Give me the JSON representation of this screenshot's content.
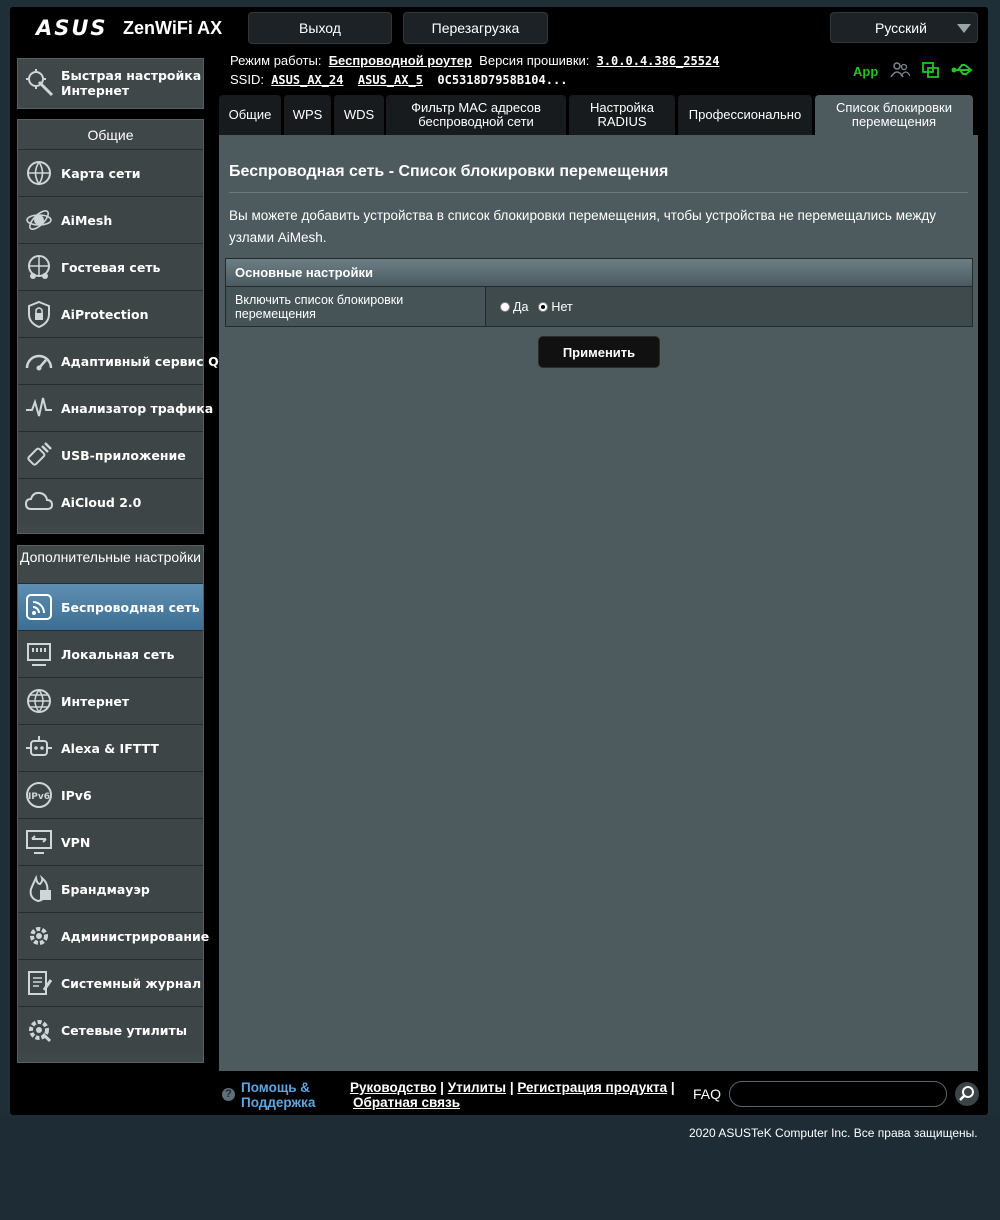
{
  "header": {
    "brand": "ASUS",
    "model": "ZenWiFi AX",
    "logout_label": "Выход",
    "reboot_label": "Перезагрузка",
    "language": "Русский",
    "mode_label": "Режим работы:",
    "mode_value": "Беспроводной роутер",
    "firmware_label": "Версия прошивки:",
    "firmware_value": "3.0.0.4.386_25524",
    "ssid_label": "SSID:",
    "ssid1": "ASUS_AX_24",
    "ssid2": "ASUS_AX_5",
    "ssid3": "0C5318D7958B104...",
    "app_label": "App",
    "accent_color": "#22c422"
  },
  "sidebar": {
    "quick_setup": "Быстрая настройка Интернет",
    "general_title": "Общие",
    "general_items": [
      {
        "label": "Карта сети",
        "icon": "network-map-icon"
      },
      {
        "label": "AiMesh",
        "icon": "aimesh-icon"
      },
      {
        "label": "Гостевая сеть",
        "icon": "guest-network-icon"
      },
      {
        "label": "AiProtection",
        "icon": "aiprotection-lock-icon"
      },
      {
        "label": "Адаптивный сервис QoS",
        "icon": "qos-gauge-icon"
      },
      {
        "label": "Анализатор трафика",
        "icon": "traffic-analyzer-icon"
      },
      {
        "label": "USB-приложение",
        "icon": "usb-icon"
      },
      {
        "label": "AiCloud 2.0",
        "icon": "cloud-icon"
      }
    ],
    "advanced_title": "Дополнительные настройки",
    "advanced_items": [
      {
        "label": "Беспроводная сеть",
        "icon": "wireless-icon",
        "active": true
      },
      {
        "label": "Локальная сеть",
        "icon": "lan-icon"
      },
      {
        "label": "Интернет",
        "icon": "globe-icon"
      },
      {
        "label": "Alexa & IFTTT",
        "icon": "alexa-icon"
      },
      {
        "label": "IPv6",
        "icon": "ipv6-icon"
      },
      {
        "label": "VPN",
        "icon": "vpn-icon"
      },
      {
        "label": "Брандмауэр",
        "icon": "firewall-icon"
      },
      {
        "label": "Администрирование",
        "icon": "gear-icon"
      },
      {
        "label": "Системный журнал",
        "icon": "system-log-icon"
      },
      {
        "label": "Сетевые утилиты",
        "icon": "network-tools-icon"
      }
    ]
  },
  "tabs": [
    {
      "label": "Общие"
    },
    {
      "label": "WPS"
    },
    {
      "label": "WDS"
    },
    {
      "label": "Фильтр MAC адресов беспроводной сети"
    },
    {
      "label": "Настройка RADIUS"
    },
    {
      "label": "Профессионально"
    },
    {
      "label": "Список блокировки перемещения",
      "active": true
    }
  ],
  "main": {
    "title": "Беспроводная сеть - Список блокировки перемещения",
    "description": "Вы можете добавить устройства в список блокировки перемещения, чтобы устройства не перемещались между узлами AiMesh.",
    "section_title": "Основные настройки",
    "row_label": "Включить список блокировки перемещения",
    "option_yes": "Да",
    "option_no": "Нет",
    "selected": "Нет",
    "apply_label": "Применить"
  },
  "footer": {
    "help_line1": "Помощь &",
    "help_line2": "Поддержка",
    "link_manual": "Руководство",
    "link_utilities": "Утилиты",
    "link_register": "Регистрация продукта",
    "link_feedback": "Обратная связь",
    "separator": "|",
    "faq_label": "FAQ",
    "faq_value": "",
    "copyright": "2020 ASUSTeK Computer Inc. Все права защищены."
  }
}
